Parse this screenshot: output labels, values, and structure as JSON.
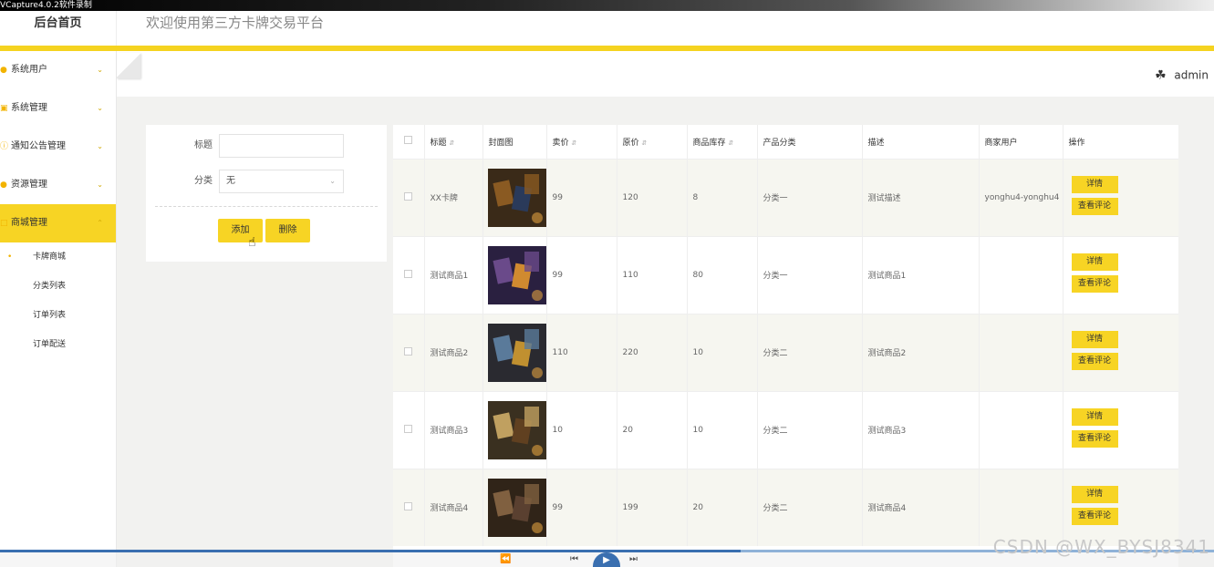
{
  "recorder": {
    "label": "VCapture4.0.2软件录制"
  },
  "header": {
    "brand": "后台首页",
    "welcome": "欢迎使用第三方卡牌交易平台",
    "user": "admin"
  },
  "sidebar": {
    "items": [
      {
        "label": "系统用户",
        "icon": "user-icon"
      },
      {
        "label": "系统管理",
        "icon": "settings-icon"
      },
      {
        "label": "通知公告管理",
        "icon": "info-icon"
      },
      {
        "label": "资源管理",
        "icon": "resource-icon"
      },
      {
        "label": "商城管理",
        "icon": "shop-icon",
        "active": true
      }
    ],
    "subitems": [
      "卡牌商城",
      "分类列表",
      "订单列表",
      "订单配送"
    ]
  },
  "search": {
    "title_label": "标题",
    "title_value": "",
    "category_label": "分类",
    "category_value": "无",
    "add_label": "添加",
    "delete_label": "删除"
  },
  "table": {
    "headers": [
      "标题",
      "封面图",
      "卖价",
      "原价",
      "商品库存",
      "产品分类",
      "描述",
      "商家用户",
      "操作"
    ],
    "detail_label": "详情",
    "comments_label": "查看评论",
    "rows": [
      {
        "title": "XX卡牌",
        "price": "99",
        "original": "120",
        "stock": "8",
        "category": "分类一",
        "desc": "测试描述",
        "merchant": "yonghu4-yonghu4"
      },
      {
        "title": "测试商品1",
        "price": "99",
        "original": "110",
        "stock": "80",
        "category": "分类一",
        "desc": "测试商品1",
        "merchant": ""
      },
      {
        "title": "测试商品2",
        "price": "110",
        "original": "220",
        "stock": "10",
        "category": "分类二",
        "desc": "测试商品2",
        "merchant": ""
      },
      {
        "title": "测试商品3",
        "price": "10",
        "original": "20",
        "stock": "10",
        "category": "分类二",
        "desc": "测试商品3",
        "merchant": ""
      },
      {
        "title": "测试商品4",
        "price": "99",
        "original": "199",
        "stock": "20",
        "category": "分类二",
        "desc": "测试商品4",
        "merchant": ""
      }
    ]
  },
  "video": {
    "progress": 0.61
  },
  "watermark": "CSDN @WX_BYSJ8341"
}
